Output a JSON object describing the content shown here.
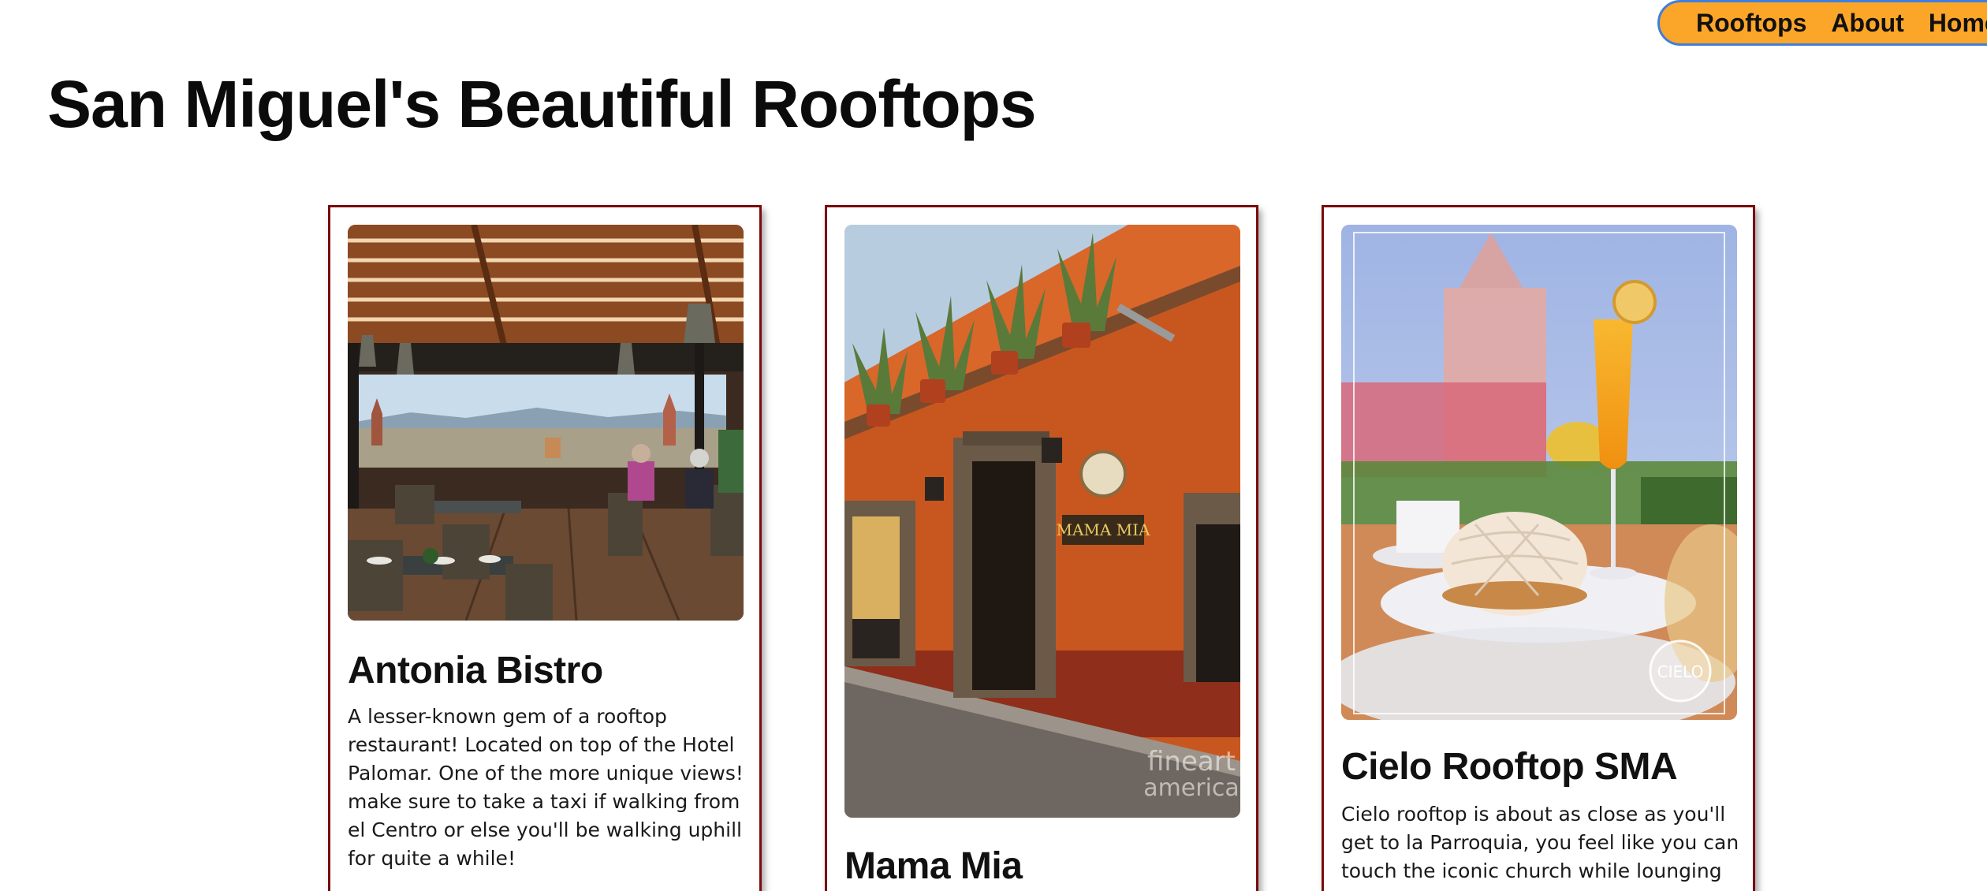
{
  "nav": {
    "items": [
      {
        "label": "Rooftops"
      },
      {
        "label": "About"
      },
      {
        "label": "Home"
      }
    ],
    "colors": {
      "background": "#fca629",
      "border": "#3f7fdc"
    }
  },
  "page": {
    "title": "San Miguel's Beautiful Rooftops"
  },
  "cards": [
    {
      "title": "Antonia Bistro",
      "description": "A lesser-known gem of a rooftop restaurant! Located on top of the Hotel Palomar. One of the more unique views! make sure to take a taxi if walking from el Centro or else you'll be walking uphill for quite a while!",
      "image_icon": "restaurant-terrace-photo"
    },
    {
      "title": "Mama Mia",
      "description": "",
      "image_icon": "orange-building-photo",
      "image_texts": {
        "sign": "MAMA MIA",
        "watermark_top": "fineart",
        "watermark_bottom": "america"
      }
    },
    {
      "title": "Cielo Rooftop SMA",
      "description": "Cielo rooftop is about as close as you'll get to la Parroquia, you feel like you can touch the iconic church while lounging",
      "image_icon": "pastry-mimosa-photo",
      "image_texts": {
        "logo": "CIELO"
      }
    }
  ],
  "colors": {
    "card_border": "#7a0c0c"
  }
}
